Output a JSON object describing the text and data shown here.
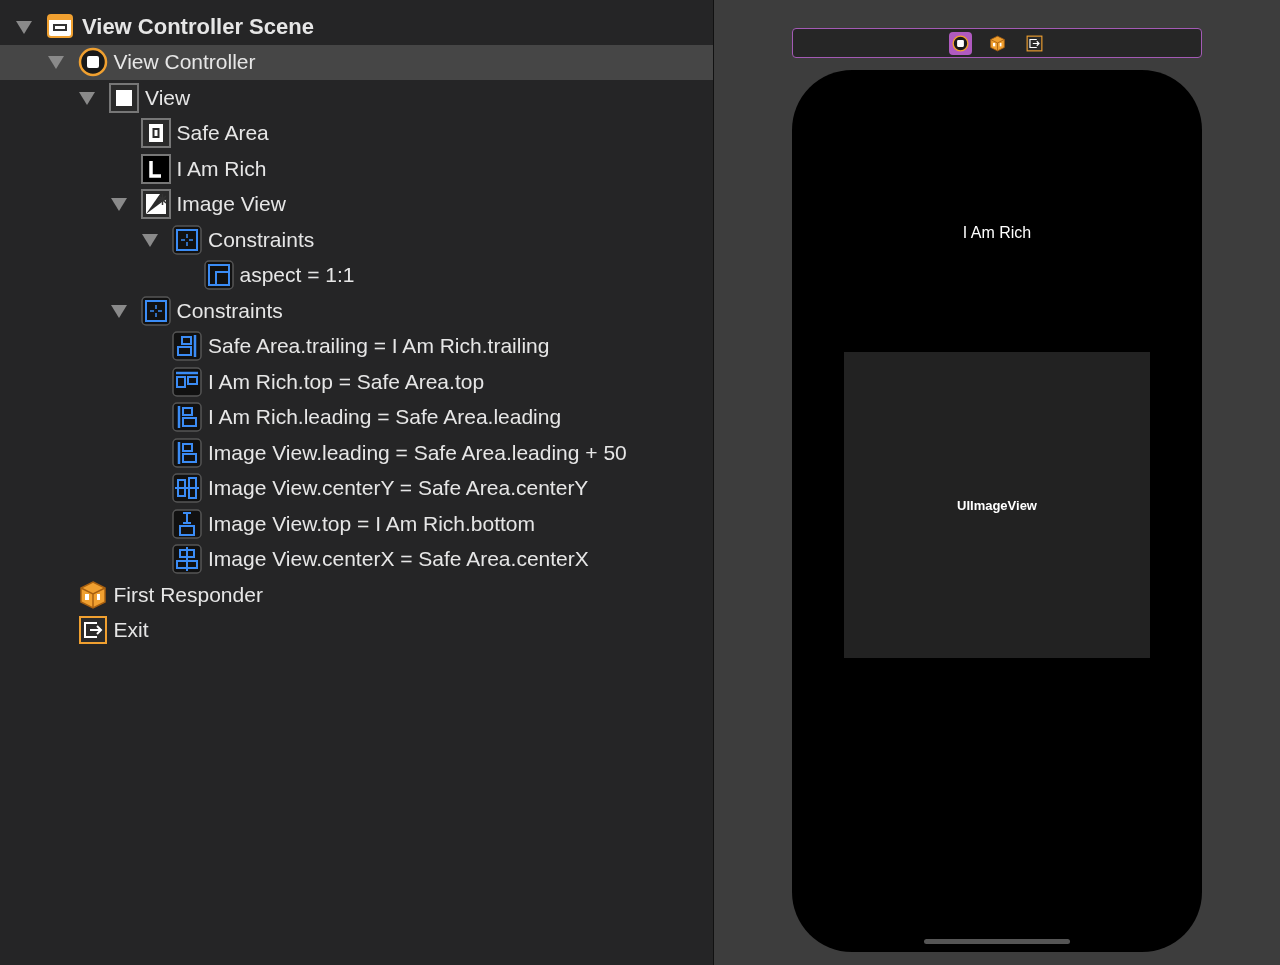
{
  "outline": [
    {
      "label": "View Controller Scene",
      "kind": "scene",
      "expanded": true,
      "selected": false,
      "children": [
        {
          "label": "View Controller",
          "kind": "controller",
          "expanded": true,
          "selected": true,
          "children": [
            {
              "label": "View",
              "kind": "view",
              "expanded": true,
              "selected": false,
              "children": [
                {
                  "label": "Safe Area",
                  "kind": "safe-area",
                  "selected": false
                },
                {
                  "label": "I Am Rich",
                  "kind": "label",
                  "selected": false
                },
                {
                  "label": "Image View",
                  "kind": "image-view",
                  "expanded": true,
                  "selected": false,
                  "children": [
                    {
                      "label": "Constraints",
                      "kind": "constraints",
                      "expanded": true,
                      "selected": false,
                      "children": [
                        {
                          "label": "aspect = 1:1",
                          "kind": "aspect",
                          "selected": false
                        }
                      ]
                    }
                  ]
                },
                {
                  "label": "Constraints",
                  "kind": "constraints",
                  "expanded": true,
                  "selected": false,
                  "children": [
                    {
                      "label": "Safe Area.trailing = I Am Rich.trailing",
                      "kind": "trailing",
                      "selected": false
                    },
                    {
                      "label": "I Am Rich.top = Safe Area.top",
                      "kind": "top",
                      "selected": false
                    },
                    {
                      "label": "I Am Rich.leading = Safe Area.leading",
                      "kind": "leading",
                      "selected": false
                    },
                    {
                      "label": "Image View.leading = Safe Area.leading + 50",
                      "kind": "leading",
                      "selected": false
                    },
                    {
                      "label": "Image View.centerY = Safe Area.centerY",
                      "kind": "center-y",
                      "selected": false
                    },
                    {
                      "label": "Image View.top = I Am Rich.bottom",
                      "kind": "spacing",
                      "selected": false
                    },
                    {
                      "label": "Image View.centerX = Safe Area.centerX",
                      "kind": "center-x",
                      "selected": false
                    }
                  ]
                }
              ]
            }
          ]
        },
        {
          "label": "First Responder",
          "kind": "responder",
          "selected": false
        },
        {
          "label": "Exit",
          "kind": "exit",
          "selected": false
        }
      ]
    }
  ],
  "canvas": {
    "dock": [
      {
        "kind": "controller",
        "selected": true
      },
      {
        "kind": "responder",
        "selected": false
      },
      {
        "kind": "exit",
        "selected": false
      }
    ],
    "label_text": "I Am Rich",
    "image_view_text": "UIImageView"
  }
}
